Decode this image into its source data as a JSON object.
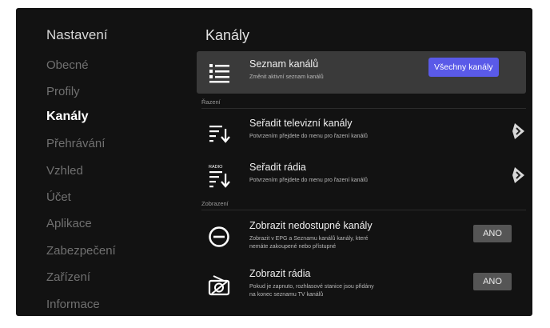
{
  "sidebar": {
    "title": "Nastavení",
    "items": [
      {
        "label": "Obecné"
      },
      {
        "label": "Profily"
      },
      {
        "label": "Kanály",
        "active": true
      },
      {
        "label": "Přehrávání"
      },
      {
        "label": "Vzhled"
      },
      {
        "label": "Účet"
      },
      {
        "label": "Aplikace"
      },
      {
        "label": "Zabezpečení"
      },
      {
        "label": "Zařízení"
      },
      {
        "label": "Informace"
      }
    ]
  },
  "main": {
    "title": "Kanály",
    "channel_list": {
      "icon": "list-icon",
      "title": "Seznam kanálů",
      "subtitle": "Změnit aktivní seznam kanálů",
      "button_label": "Všechny kanály"
    },
    "sort_section": {
      "label": "Řazení",
      "items": [
        {
          "icon": "sort-icon",
          "title": "Seřadit televizní kanály",
          "subtitle": "Potvrzením přejdete do menu pro řazení kanálů"
        },
        {
          "icon": "radio-sort-icon",
          "icon_text": "RADIO",
          "title": "Seřadit rádia",
          "subtitle": "Potvrzením přejdete do menu pro řazení kanálů"
        }
      ]
    },
    "display_section": {
      "label": "Zobrazení",
      "items": [
        {
          "icon": "unavailable-icon",
          "title": "Zobrazit nedostupné kanály",
          "subtitle_lines": [
            "Zobrazit v EPG a Seznamu kanálů kanály, které",
            "nemáte zakoupené nebo přístupné"
          ],
          "value": "ANO"
        },
        {
          "icon": "radio-icon",
          "title": "Zobrazit rádia",
          "subtitle_lines": [
            "Pokud je zapnuto, rozhlasové stanice jsou přidány",
            "na konec seznamu TV kanálů"
          ],
          "value": "ANO"
        }
      ]
    }
  },
  "colors": {
    "accent": "#5a5ae8",
    "background": "#121212",
    "highlight": "#3a3a3a",
    "toggle": "#555555"
  }
}
